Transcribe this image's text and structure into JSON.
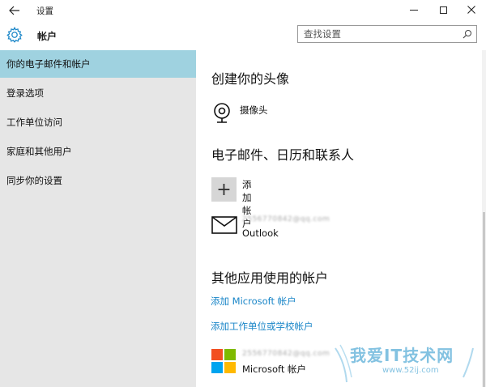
{
  "window": {
    "title": "设置",
    "back_icon": "arrow-left-icon",
    "controls": [
      "minimize-icon",
      "maximize-icon",
      "close-icon"
    ]
  },
  "header": {
    "icon": "gear-icon",
    "title": "帐户",
    "search_placeholder": "查找设置"
  },
  "sidebar": {
    "items": [
      {
        "label": "你的电子邮件和帐户",
        "active": true
      },
      {
        "label": "登录选项",
        "active": false
      },
      {
        "label": "工作单位访问",
        "active": false
      },
      {
        "label": "家庭和其他用户",
        "active": false
      },
      {
        "label": "同步你的设置",
        "active": false
      }
    ]
  },
  "main": {
    "avatar_section": {
      "title": "创建你的头像",
      "camera_label": "摄像头"
    },
    "email_section": {
      "title": "电子邮件、日历和联系人",
      "add_account_label": "添加帐户",
      "outlook_email": "2556770842@qq.com",
      "outlook_label": "Outlook"
    },
    "other_apps_section": {
      "title": "其他应用使用的帐户",
      "add_microsoft_link": "添加 Microsoft 帐户",
      "add_work_link": "添加工作单位或学校帐户",
      "ms_email": "2556770842@qq.com",
      "ms_label": "Microsoft 帐户"
    }
  },
  "watermark": {
    "text": "我爱IT技术网",
    "url": "www.52ij.com"
  },
  "colors": {
    "accent_link": "#1a86c8",
    "sidebar_bg": "#e6e6e6",
    "sidebar_active": "#9fd2e0",
    "ms_logo": [
      "#f25022",
      "#7fba00",
      "#00a4ef",
      "#ffb900"
    ]
  }
}
